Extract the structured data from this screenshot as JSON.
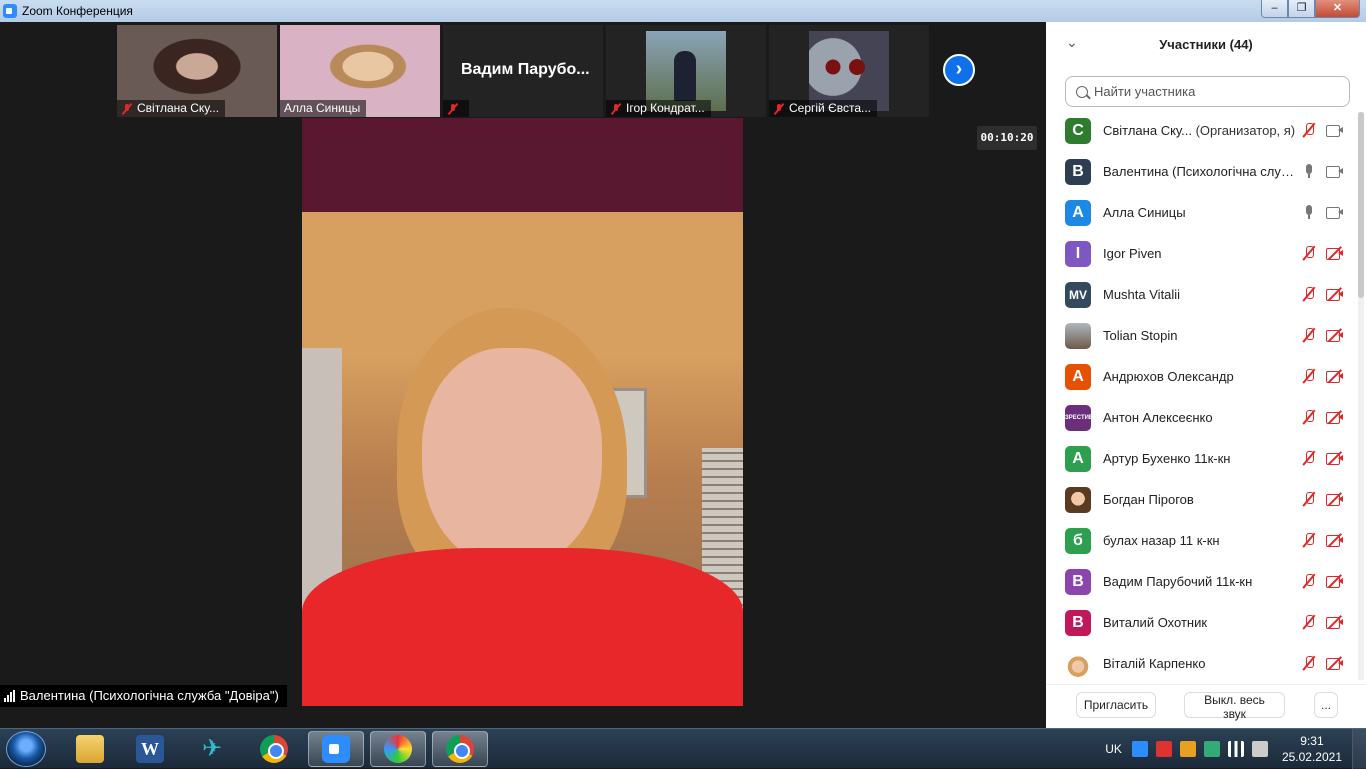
{
  "window": {
    "title": "Zoom Конференция"
  },
  "thumbnails": [
    {
      "name": "Світлана Ску...",
      "muted": true
    },
    {
      "name": "Алла Синицы",
      "muted": false
    },
    {
      "name": "",
      "big_name": "Вадим  Парубо...",
      "muted": true
    },
    {
      "name": "Ігор Кондрат...",
      "muted": true
    },
    {
      "name": "Сергій Євста...",
      "muted": true
    }
  ],
  "meeting": {
    "timer": "00:10:20",
    "active_speaker": "Валентина (Психологічна служба \"Довіра\")"
  },
  "participants_panel": {
    "title": "Участники (44)",
    "search_placeholder": "Найти участника",
    "items": [
      {
        "avatar_text": "С",
        "avatar_color": "#2e7d2e",
        "name": "Світлана Ску...",
        "role": "(Организатор, я)",
        "mic": "muted",
        "camera": "on"
      },
      {
        "avatar_text": "В",
        "avatar_color": "#2c3e50",
        "name": "Валентина (Психологічна служ...",
        "role": "",
        "mic": "on",
        "camera": "on"
      },
      {
        "avatar_text": "А",
        "avatar_color": "#1e88e5",
        "name": "Алла Синицы",
        "role": "",
        "mic": "on",
        "camera": "on"
      },
      {
        "avatar_text": "I",
        "avatar_color": "#7e57c2",
        "name": "Igor Piven",
        "role": "",
        "mic": "muted",
        "camera": "off"
      },
      {
        "avatar_text": "MV",
        "avatar_color": "#34495e",
        "name": "Mushta Vitalii",
        "role": "",
        "mic": "muted",
        "camera": "off"
      },
      {
        "avatar_text": "",
        "avatar_color": "photo",
        "name": "Tolian Stopin",
        "role": "",
        "mic": "muted",
        "camera": "off"
      },
      {
        "avatar_text": "А",
        "avatar_color": "#e65100",
        "name": "Андрюхов Олександр",
        "role": "",
        "mic": "muted",
        "camera": "off"
      },
      {
        "avatar_text": "ЗРЕСТИВ",
        "avatar_color": "photo",
        "name": "Антон Алексеєнко",
        "role": "",
        "mic": "muted",
        "camera": "off"
      },
      {
        "avatar_text": "А",
        "avatar_color": "#2e9e4f",
        "name": "Артур Бухенко 11к-кн",
        "role": "",
        "mic": "muted",
        "camera": "off"
      },
      {
        "avatar_text": "",
        "avatar_color": "photo",
        "name": "Богдан Пірогов",
        "role": "",
        "mic": "muted",
        "camera": "off"
      },
      {
        "avatar_text": "б",
        "avatar_color": "#2e9e4f",
        "name": "булах назар 11 к-кн",
        "role": "",
        "mic": "muted",
        "camera": "off"
      },
      {
        "avatar_text": "В",
        "avatar_color": "#8e44ad",
        "name": "Вадим Парубочий 11к-кн",
        "role": "",
        "mic": "muted",
        "camera": "off"
      },
      {
        "avatar_text": "В",
        "avatar_color": "#c2185b",
        "name": "Виталий Охотник",
        "role": "",
        "mic": "muted",
        "camera": "off"
      },
      {
        "avatar_text": "",
        "avatar_color": "photo",
        "name": "Віталій Карпенко",
        "role": "",
        "mic": "muted",
        "camera": "off"
      }
    ],
    "buttons": {
      "invite": "Пригласить",
      "mute_all": "Выкл. весь звук",
      "more": "..."
    }
  },
  "taskbar": {
    "language": "UK",
    "time": "9:31",
    "date": "25.02.2021",
    "apps": [
      "file-explorer",
      "word",
      "hummingbird",
      "chrome",
      "zoom",
      "paint",
      "chrome"
    ]
  }
}
